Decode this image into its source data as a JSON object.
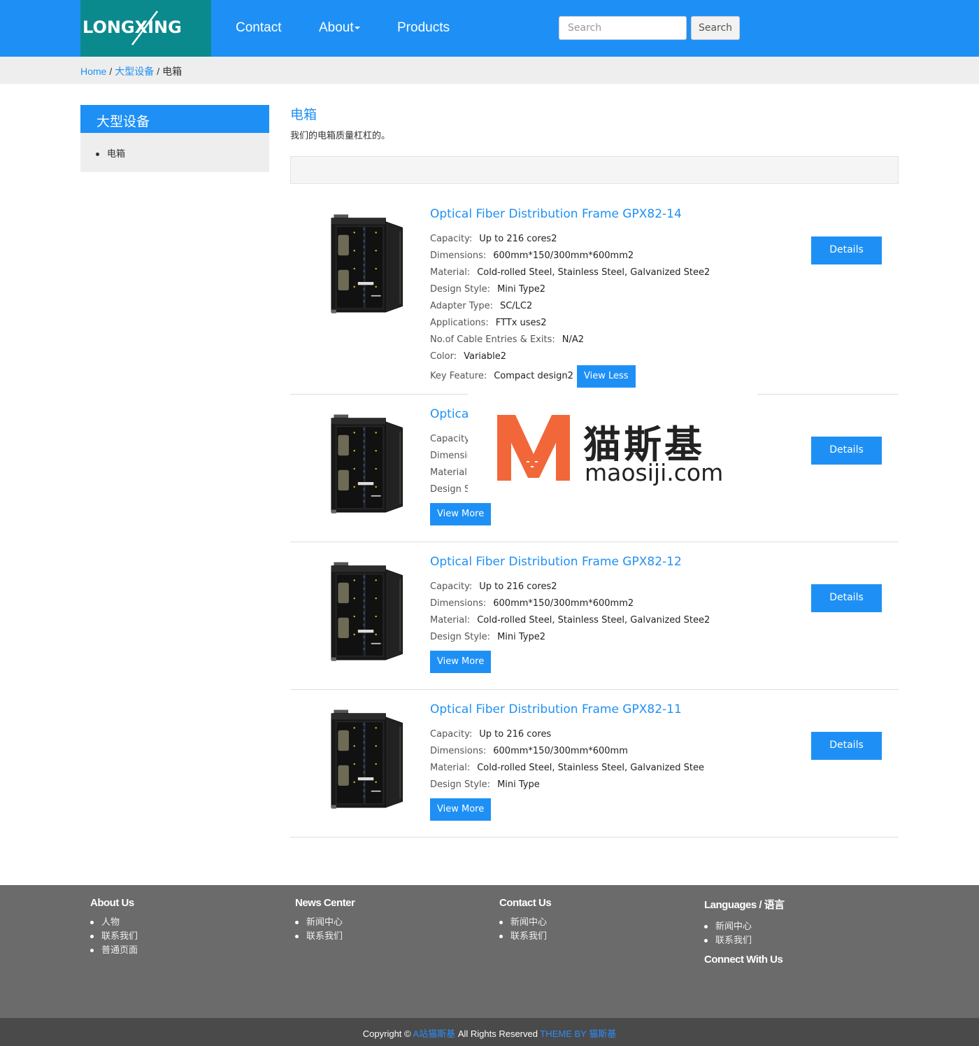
{
  "header": {
    "logo_text": "LONGXING",
    "nav": [
      {
        "label": "Contact"
      },
      {
        "label": "About"
      },
      {
        "label": "Products"
      }
    ],
    "search_placeholder": "Search",
    "search_button": "Search"
  },
  "breadcrumb": {
    "home": "Home",
    "sep": "/",
    "parent": "大型设备",
    "current": "电箱"
  },
  "sidebar": {
    "title": "大型设备",
    "items": [
      {
        "label": "电箱"
      }
    ]
  },
  "category": {
    "title": "电箱",
    "description": "我们的电箱质量杠杠的。"
  },
  "products": [
    {
      "title": "Optical Fiber Distribution Frame GPX82-14",
      "specs": [
        {
          "k": "Capacity:",
          "v": "Up to 216 cores2"
        },
        {
          "k": "Dimensions:",
          "v": "600mm*150/300mm*600mm2"
        },
        {
          "k": "Material:",
          "v": "Cold-rolled Steel, Stainless Steel, Galvanized Stee2"
        },
        {
          "k": "Design Style:",
          "v": "Mini Type2"
        },
        {
          "k": "Adapter Type:",
          "v": "SC/LC2"
        },
        {
          "k": "Applications:",
          "v": "FTTx uses2"
        },
        {
          "k": "No.of Cable Entries & Exits:",
          "v": "N/A2"
        },
        {
          "k": "Color:",
          "v": "Variable2"
        },
        {
          "k": "Key Feature:",
          "v": "Compact design2"
        }
      ],
      "toggle": "View Less",
      "details": "Details"
    },
    {
      "title": "Optical",
      "specs": [
        {
          "k": "Capacity:",
          "v": ""
        },
        {
          "k": "Dimensic",
          "v": ""
        },
        {
          "k": "Material:",
          "v": ""
        },
        {
          "k": "Design St",
          "v": ""
        }
      ],
      "toggle": "View More",
      "details": "Details"
    },
    {
      "title": "Optical Fiber Distribution Frame GPX82-12",
      "specs": [
        {
          "k": "Capacity:",
          "v": "Up to 216 cores2"
        },
        {
          "k": "Dimensions:",
          "v": "600mm*150/300mm*600mm2"
        },
        {
          "k": "Material:",
          "v": "Cold-rolled Steel, Stainless Steel, Galvanized Stee2"
        },
        {
          "k": "Design Style:",
          "v": "Mini Type2"
        }
      ],
      "toggle": "View More",
      "details": "Details"
    },
    {
      "title": "Optical Fiber Distribution Frame GPX82-11",
      "specs": [
        {
          "k": "Capacity:",
          "v": "Up to 216 cores"
        },
        {
          "k": "Dimensions:",
          "v": "600mm*150/300mm*600mm"
        },
        {
          "k": "Material:",
          "v": "Cold-rolled Steel, Stainless Steel, Galvanized Stee"
        },
        {
          "k": "Design Style:",
          "v": "Mini Type"
        }
      ],
      "toggle": "View More",
      "details": "Details"
    }
  ],
  "watermark": {
    "cn": "猫斯基",
    "en": "maosiji.com"
  },
  "footer": {
    "columns": [
      {
        "title": "About Us",
        "items": [
          "人物",
          "联系我们",
          "普通页面"
        ]
      },
      {
        "title": "News Center",
        "items": [
          "新闻中心",
          "联系我们"
        ]
      },
      {
        "title": "Contact Us",
        "items": [
          "新闻中心",
          "联系我们"
        ]
      },
      {
        "title": "Languages / 语言",
        "items": [
          "新闻中心",
          "联系我们"
        ]
      }
    ],
    "connect": "Connect With Us",
    "copyright_prefix": "Copyright ©",
    "copyright_link": "A站猫斯基",
    "copyright_mid": "All Rights Reserved",
    "theme_by": "THEME BY",
    "theme_link": "猫斯基"
  },
  "colors": {
    "primary": "#1e90f5",
    "logo_bg": "#0b8a8e",
    "footer_bg": "#6b6b6b",
    "copyright_bg": "#4a4a4a",
    "watermark_red": "#f2673a"
  }
}
